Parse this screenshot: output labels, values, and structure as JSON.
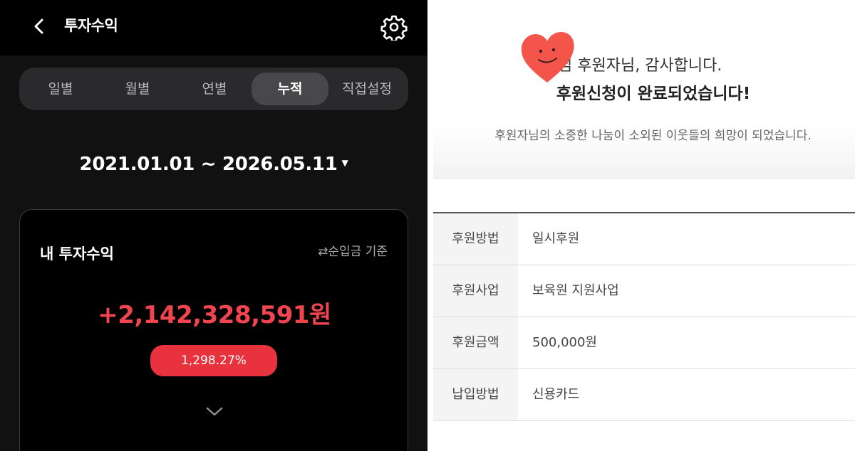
{
  "left": {
    "header": {
      "title": "투자수익",
      "back_icon": "chevron-left-icon",
      "settings_icon": "gear-icon"
    },
    "tabs": [
      {
        "label": "일별",
        "active": false
      },
      {
        "label": "월별",
        "active": false
      },
      {
        "label": "연별",
        "active": false
      },
      {
        "label": "누적",
        "active": true
      },
      {
        "label": "직접설정",
        "active": false
      }
    ],
    "date_range": "2021.01.01 ~ 2026.05.11",
    "date_caret": "▼",
    "card": {
      "title": "내 투자수익",
      "basis_label": "⇄순입금 기준",
      "profit": "+2,142,328,591원",
      "percent": "1,298.27%",
      "expand_icon": "chevron-down-icon"
    },
    "colors": {
      "profit_red": "#f0454e",
      "badge_red": "#e8323d",
      "background": "#111111"
    }
  },
  "right": {
    "thanks_text": "님 후원자님, 감사합니다.",
    "done_text": "후원신청이 완료되었습니다!",
    "sub_text": "후원자님의 소중한 나눔이 소외된 이웃들의 희망이 되었습니다.",
    "sticker": "heart-smiley-sticker",
    "table": [
      {
        "label": "후원방법",
        "value": "일시후원"
      },
      {
        "label": "후원사업",
        "value": "보육원 지원사업"
      },
      {
        "label": "후원금액",
        "value": "500,000원"
      },
      {
        "label": "납입방법",
        "value": "신용카드"
      }
    ],
    "colors": {
      "heart": "#f4554a"
    }
  }
}
